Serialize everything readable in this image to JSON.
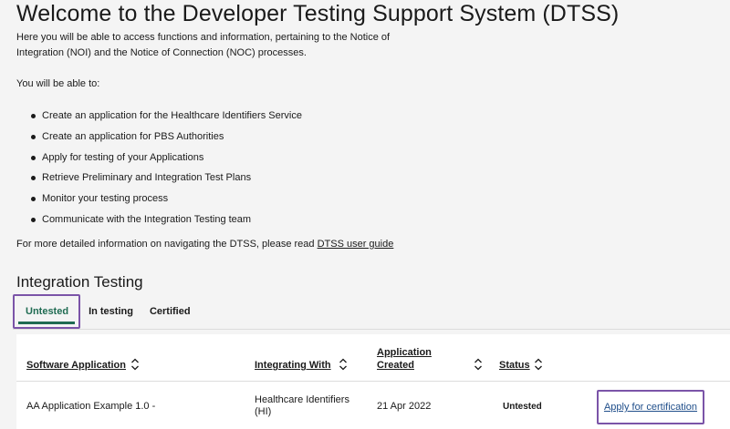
{
  "header": {
    "title": "Welcome to the Developer Testing Support System (DTSS)",
    "intro": "Here you will be able to access functions and information, pertaining to the Notice of Integration (NOI) and the Notice of Connection (NOC) processes.",
    "able_to": "You will be able to:"
  },
  "features": [
    "Create an application for the Healthcare Identifiers Service",
    "Create an application for PBS Authorities",
    "Apply for testing of your Applications",
    "Retrieve Preliminary and Integration Test Plans",
    "Monitor your testing process",
    "Communicate with the Integration Testing team"
  ],
  "more_info": {
    "text": "For more detailed information on navigating the DTSS, please read ",
    "link": "DTSS user guide"
  },
  "section": {
    "title": "Integration Testing"
  },
  "tabs": [
    {
      "label": "Untested",
      "active": true
    },
    {
      "label": "In testing",
      "active": false
    },
    {
      "label": "Certified",
      "active": false
    }
  ],
  "table": {
    "columns": {
      "software": "Software Application",
      "integrating": "Integrating With",
      "created_line1": "Application",
      "created_line2": "Created",
      "status": "Status"
    },
    "rows": [
      {
        "software": "AA Application Example 1.0 -",
        "integrating": "Healthcare Identifiers (HI)",
        "created": "21 Apr 2022",
        "status": "Untested",
        "action": "Apply for certification"
      }
    ]
  },
  "colors": {
    "accent_green": "#1f6b52",
    "focus_purple": "#7b54a8",
    "link_blue": "#1f4e8a",
    "background": "#f4f4f4"
  }
}
